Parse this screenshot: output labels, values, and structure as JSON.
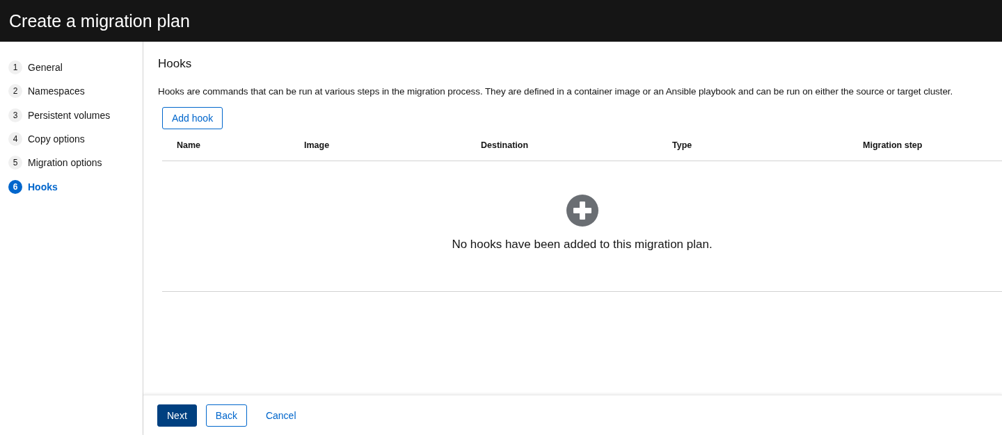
{
  "header": {
    "title": "Create a migration plan"
  },
  "steps": [
    {
      "number": "1",
      "label": "General",
      "selected": false
    },
    {
      "number": "2",
      "label": "Namespaces",
      "selected": false
    },
    {
      "number": "3",
      "label": "Persistent volumes",
      "selected": false
    },
    {
      "number": "4",
      "label": "Copy options",
      "selected": false
    },
    {
      "number": "5",
      "label": "Migration options",
      "selected": false
    },
    {
      "number": "6",
      "label": "Hooks",
      "selected": true
    }
  ],
  "section": {
    "title": "Hooks",
    "description": "Hooks are commands that can be run at various steps in the migration process. They are defined in a container image or an Ansible playbook and can be run on either the source or target cluster.",
    "add_button": "Add hook"
  },
  "table": {
    "columns": [
      "Name",
      "Image",
      "Destination",
      "Type",
      "Migration step"
    ],
    "empty_message": "No hooks have been added to this migration plan."
  },
  "footer": {
    "buttons": [
      {
        "label": "Next",
        "kind": "primary"
      },
      {
        "label": "Back",
        "kind": "secondary"
      },
      {
        "label": "Cancel",
        "kind": "link"
      }
    ]
  }
}
